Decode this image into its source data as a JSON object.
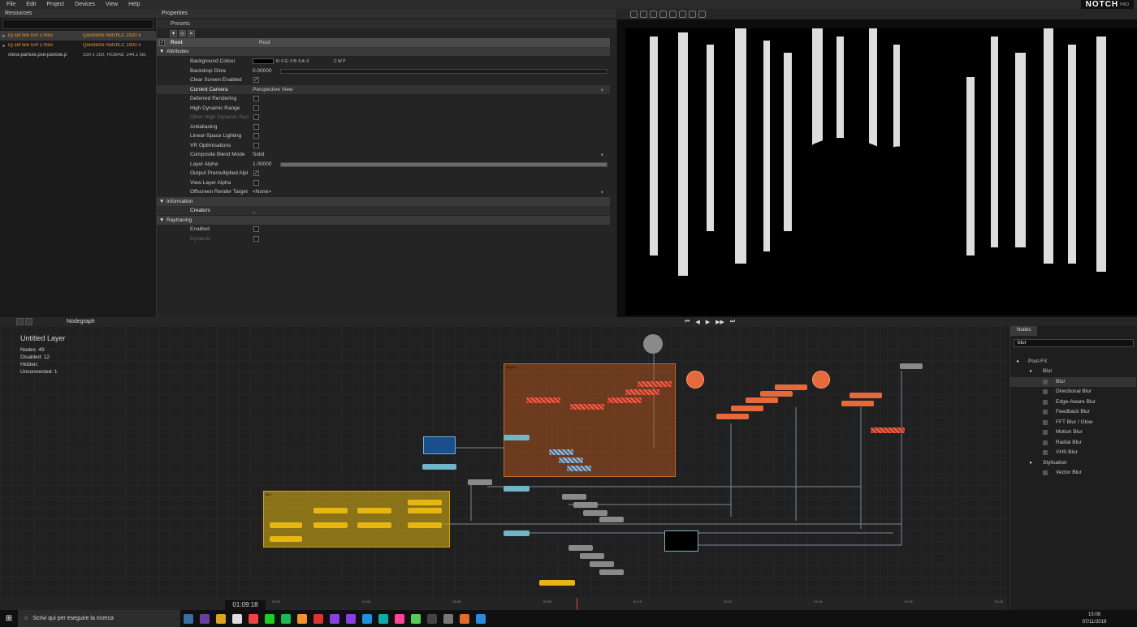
{
  "menu": [
    "File",
    "Edit",
    "Project",
    "Devices",
    "View",
    "Help"
  ],
  "logo": {
    "brand": "NOTCH",
    "edition": "PRO"
  },
  "resources": {
    "title": "Resources",
    "items": [
      {
        "name": "Dj set live Girl 2.mov",
        "type": "Quicktime NotchLC 1920 x"
      },
      {
        "name": "Dj set live Girl 2.mov",
        "type": "Quicktime NotchLC 1920 x"
      },
      {
        "name": "sfera-particle.psd-particle.p",
        "type": "250 x 250, RGBA8, 244.1 kB,"
      }
    ]
  },
  "properties": {
    "title": "Properties",
    "presets": "Presets",
    "root_label": "Root",
    "root_value": "Root",
    "attributes": "Attributes",
    "rows": {
      "bg": "Background Colour",
      "bg_val": "R: 0 G: 0 B: 0 A: 0",
      "cwp": "C    W    P",
      "glow": "Backdrop Glow",
      "glow_val": "0.00000",
      "clear": "Clear Screen Enabled",
      "camera": "Current Camera",
      "camera_val": "Perspective View",
      "deferred": "Deferred Rendering",
      "hdr": "High Dynamic Range",
      "ohdr": "Other High Dynamic Ran",
      "aa": "Antialiasing",
      "lin": "Linear-Space Lighting",
      "vr": "VR Optimisations",
      "blend": "Composite Blend Mode",
      "blend_val": "Solid",
      "alpha": "Layer Alpha",
      "alpha_val": "1.00000",
      "premult": "Output Premultiplied Alpl",
      "viewalpha": "View Layer Alpha",
      "offscreen": "Offscreen Render Target",
      "offscreen_val": "<None>"
    },
    "information": "Information",
    "creators": "Creators",
    "creators_val": "_",
    "raytracing": "Raytracing",
    "enabled": "Enabled",
    "dynamic": "Dynamic"
  },
  "nodegraph": {
    "tab": "Nodegraph",
    "layer": "Untitled  Layer",
    "stats": [
      "Nodes:  49",
      "Disabled:  12",
      "Hidden:",
      "Unconnected:  1"
    ],
    "region": "Region",
    "mix": "MIX"
  },
  "nodes_panel": {
    "tabs": [
      "Nodes"
    ],
    "search": "blur",
    "tree": [
      "Post-FX",
      "Blur",
      "Blur",
      "Directional Blur",
      "Edge-Aware Blur",
      "Feedback Blur",
      "FFT Blur / Glow",
      "Motion Blur",
      "Radial Blur",
      "VHS Blur",
      "Stylisation",
      "Vector Blur"
    ]
  },
  "timeline": {
    "timecode": "01:09:18",
    "ticks": [
      "01:02",
      "01:04",
      "01:06",
      "01:08",
      "01:10",
      "01:12",
      "01:14",
      "01:16",
      "01:18"
    ]
  },
  "taskbar": {
    "search": "Scrivi qui per eseguire la ricerca",
    "time": "15:08",
    "date": "07/11/2019"
  }
}
